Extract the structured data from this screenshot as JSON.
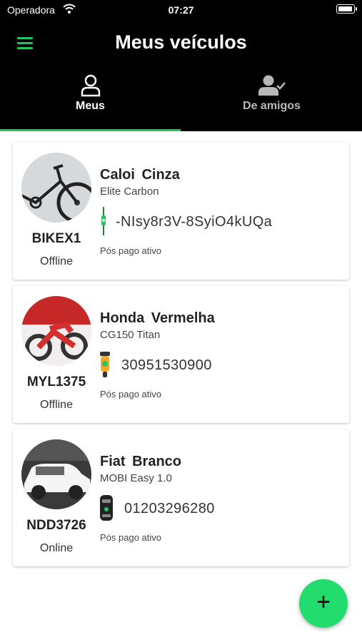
{
  "status_bar": {
    "carrier": "Operadora",
    "time": "07:27",
    "battery_level": 0.95
  },
  "header": {
    "title": "Meus veículos",
    "menu_icon": "hamburger-menu-icon"
  },
  "tabs": [
    {
      "label": "Meus",
      "icon": "user-icon",
      "active": true
    },
    {
      "label": "De amigos",
      "icon": "user-check-icon",
      "active": false
    }
  ],
  "vehicles": [
    {
      "name": "Caloi  Cinza",
      "model": "Elite Carbon",
      "plate": "BIKEX1",
      "connection": "Offline",
      "device_icon": "bike-tracker-icon",
      "device_id": "-NIsy8r3V-8SyiO4kUQa",
      "plan": "Pós pago ativo",
      "photo": "bicycle-photo"
    },
    {
      "name": "Honda  Vermelha",
      "model": "CG150 Titan",
      "plate": "MYL1375",
      "connection": "Offline",
      "device_icon": "motorcycle-tracker-icon",
      "device_id": "30951530900",
      "plan": "Pós pago ativo",
      "photo": "motorcycle-photo"
    },
    {
      "name": "Fiat  Branco",
      "model": "MOBI Easy 1.0",
      "plate": "NDD3726",
      "connection": "Online",
      "device_icon": "car-tracker-icon",
      "device_id": "01203296280",
      "plan": "Pós pago ativo",
      "photo": "car-photo"
    }
  ],
  "fab": {
    "label": "+",
    "icon": "plus-icon"
  },
  "colors": {
    "accent": "#22c55e",
    "fab": "#22dd6e",
    "header_bg": "#000000"
  }
}
